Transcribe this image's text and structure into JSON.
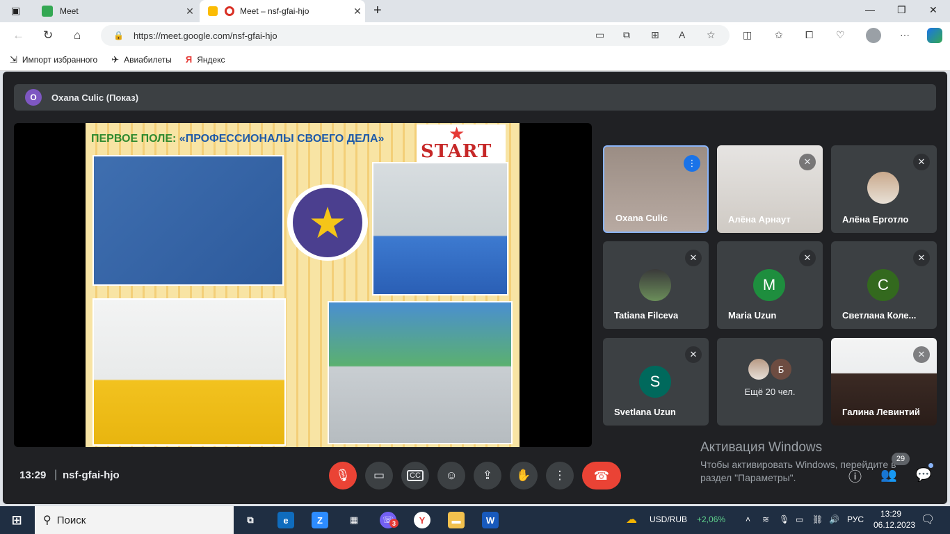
{
  "browser": {
    "tabs": [
      {
        "title": "Meet"
      },
      {
        "title": "Meet – nsf-gfai-hjo"
      }
    ],
    "url": "https://meet.google.com/nsf-gfai-hjo",
    "bookmarks": [
      "Импорт избранного",
      "Авиабилеты",
      "Яндекс"
    ]
  },
  "meet": {
    "presenter_initial": "O",
    "presenter_label": "Oxana Culic (Показ)",
    "slide": {
      "title_prefix": "ПЕРВОЕ ПОЛЕ:",
      "title_main": " «ПРОФЕССИОНАЛЫ СВОЕГО ДЕЛА»",
      "logo_text": "START"
    },
    "participants": [
      {
        "name": "Oxana Culic",
        "type": "video",
        "mic": "speaking"
      },
      {
        "name": "Алёна Арнаут",
        "type": "video",
        "mic": "muted"
      },
      {
        "name": "Алёна Ерготло",
        "type": "photo",
        "mic": "muted"
      },
      {
        "name": "Tatiana Filceva",
        "type": "photo",
        "mic": "muted"
      },
      {
        "name": "Maria Uzun",
        "type": "letter",
        "letter": "M",
        "color": "#1e8e3e",
        "mic": "muted"
      },
      {
        "name": "Светлана Коле...",
        "type": "letter",
        "letter": "C",
        "color": "#33691e",
        "mic": "muted"
      },
      {
        "name": "Svetlana Uzun",
        "type": "letter",
        "letter": "S",
        "color": "#00695c",
        "mic": "muted"
      },
      {
        "name": "Ещё 20 чел.",
        "type": "more",
        "mini_letter": "Б"
      },
      {
        "name": "Галина Левинтий",
        "type": "video",
        "mic": "muted"
      }
    ],
    "time": "13:29",
    "meeting_code": "nsf-gfai-hjo",
    "people_count": "29",
    "activation": {
      "title": "Активация Windows",
      "text": "Чтобы активировать Windows, перейдите в раздел \"Параметры\"."
    }
  },
  "taskbar": {
    "search_label": "Поиск",
    "ticker": "USD/RUB",
    "ticker_change": "+2,06%",
    "lang": "РУС",
    "time": "13:29",
    "date": "06.12.2023",
    "viber_badge": "3"
  }
}
